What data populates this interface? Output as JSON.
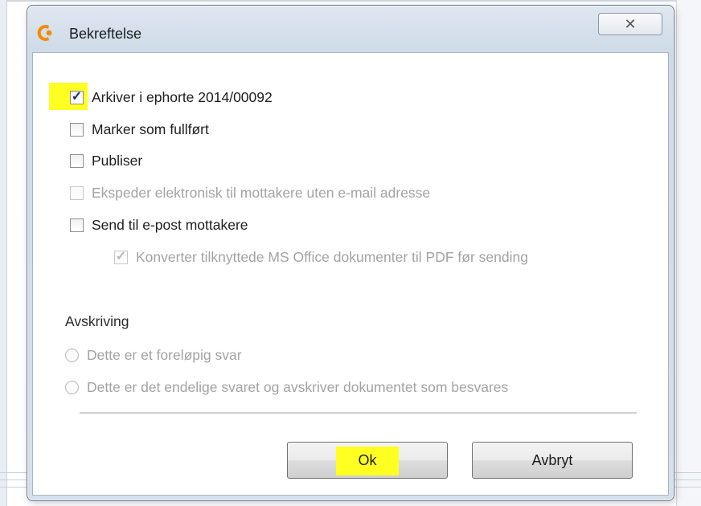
{
  "dialog": {
    "title": "Bekreftelse",
    "close_glyph": "✕"
  },
  "options": [
    {
      "label": "Arkiver i ephorte 2014/00092",
      "checked": true,
      "enabled": true
    },
    {
      "label": "Marker som fullført",
      "checked": false,
      "enabled": true
    },
    {
      "label": "Publiser",
      "checked": false,
      "enabled": true
    },
    {
      "label": "Ekspeder elektronisk til mottakere uten e-mail adresse",
      "checked": false,
      "enabled": false
    },
    {
      "label": "Send til e-post mottakere",
      "checked": false,
      "enabled": true
    },
    {
      "label": "Konverter tilknyttede MS Office dokumenter til PDF før sending",
      "checked": true,
      "enabled": false
    }
  ],
  "avskriving": {
    "heading": "Avskriving",
    "choices": [
      {
        "label": "Dette er et foreløpig svar",
        "selected": false,
        "enabled": false
      },
      {
        "label": "Dette er det endelige svaret og avskriver dokumentet som besvares",
        "selected": false,
        "enabled": false
      }
    ]
  },
  "buttons": {
    "ok": "Ok",
    "cancel": "Avbryt"
  },
  "icons": {
    "app": "ephorte-logo-icon",
    "check": "✓",
    "close": "close-icon"
  },
  "colors": {
    "highlight": "#ffff22",
    "logo": "#f28c00",
    "check": "#1e2c63"
  }
}
